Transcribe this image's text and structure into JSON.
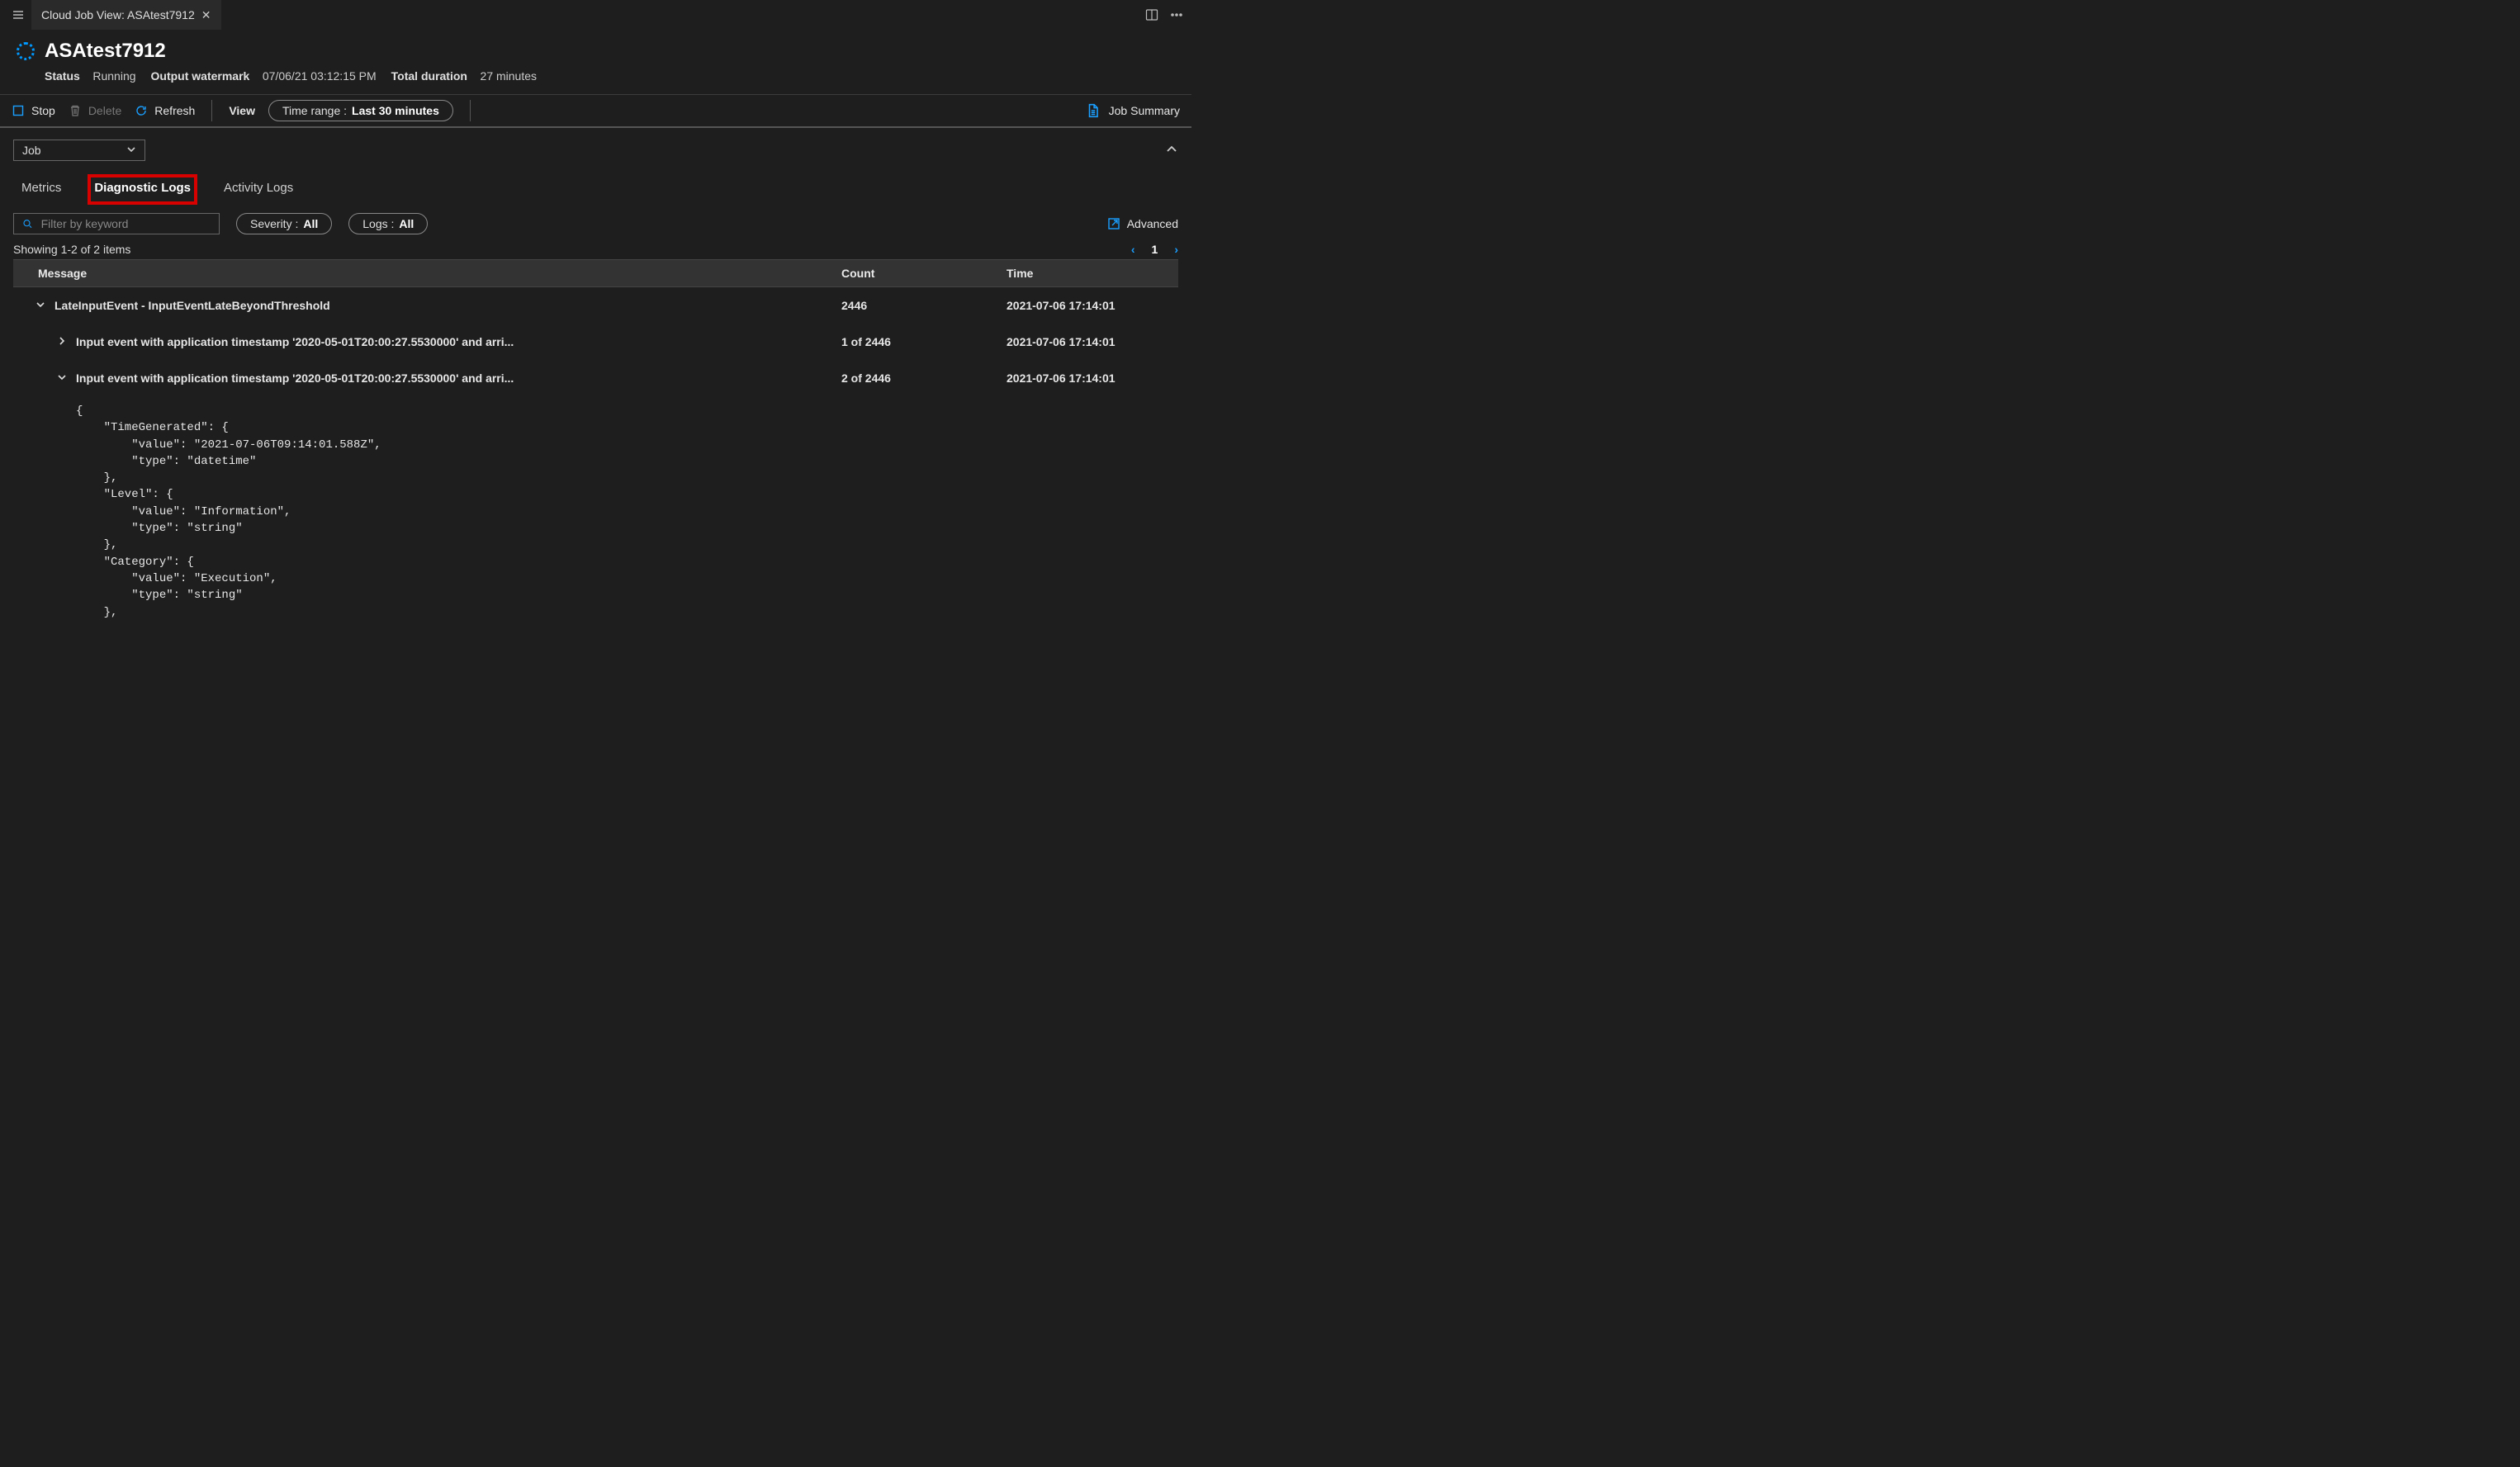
{
  "tabbar": {
    "title": "Cloud Job View: ASAtest7912"
  },
  "header": {
    "title": "ASAtest7912",
    "status_label": "Status",
    "status_value": "Running",
    "watermark_label": "Output watermark",
    "watermark_value": "07/06/21 03:12:15 PM",
    "duration_label": "Total duration",
    "duration_value": "27 minutes"
  },
  "toolbar": {
    "stop": "Stop",
    "delete": "Delete",
    "refresh": "Refresh",
    "view": "View",
    "time_range_label": "Time range :",
    "time_range_value": "Last 30 minutes",
    "job_summary": "Job Summary"
  },
  "subbar": {
    "dropdown_value": "Job"
  },
  "tabs": {
    "metrics": "Metrics",
    "diag": "Diagnostic Logs",
    "activity": "Activity Logs"
  },
  "filters": {
    "search_placeholder": "Filter by keyword",
    "severity_label": "Severity :",
    "severity_value": "All",
    "logs_label": "Logs :",
    "logs_value": "All",
    "advanced": "Advanced"
  },
  "paging": {
    "showing": "Showing 1-2 of 2 items",
    "page": "1"
  },
  "table": {
    "headers": {
      "message": "Message",
      "count": "Count",
      "time": "Time"
    },
    "rows": [
      {
        "expanded": true,
        "indent": 0,
        "message": "LateInputEvent - InputEventLateBeyondThreshold",
        "count": "2446",
        "time": "2021-07-06 17:14:01",
        "bold": true
      },
      {
        "expanded": false,
        "indent": 1,
        "message": "Input event with application timestamp '2020-05-01T20:00:27.5530000' and arri...",
        "count": "1 of 2446",
        "time": "2021-07-06 17:14:01",
        "bold": true
      },
      {
        "expanded": true,
        "indent": 1,
        "message": "Input event with application timestamp '2020-05-01T20:00:27.5530000' and arri...",
        "count": "2 of 2446",
        "time": "2021-07-06 17:14:01",
        "bold": true
      }
    ],
    "json_detail": "{\n    \"TimeGenerated\": {\n        \"value\": \"2021-07-06T09:14:01.588Z\",\n        \"type\": \"datetime\"\n    },\n    \"Level\": {\n        \"value\": \"Information\",\n        \"type\": \"string\"\n    },\n    \"Category\": {\n        \"value\": \"Execution\",\n        \"type\": \"string\"\n    },"
  }
}
